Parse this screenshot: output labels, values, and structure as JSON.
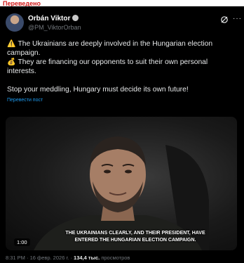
{
  "page_label": "Переведено",
  "post": {
    "author_name": "Orbán Viktor",
    "author_handle": "@PM_ViktorOrban",
    "lines": [
      "The Ukrainians are deeply involved in the Hungarian election campaign.",
      "They are financing our opponents to suit their own personal interests.",
      "Stop your meddling, Hungary must decide its own future!"
    ],
    "line_icons": [
      "warning-emoji",
      "money-bag-emoji"
    ],
    "translate_link": "Перевести пост",
    "video": {
      "duration": "1:00",
      "subtitle": "THE UKRAINIANS CLEARLY, AND THEIR PRESIDENT, HAVE ENTERED THE HUNGARIAN ELECTION CAMPAIGN."
    },
    "timestamp": "8:31 PM · 16 февр. 2026 г. ·",
    "views_count": "134,4 тыс.",
    "views_label": "просмотров"
  },
  "colors": {
    "background": "#000000",
    "text": "#e7e9ea",
    "muted": "#71767b",
    "link": "#1d9bf0",
    "label_red": "#d11a1a"
  }
}
